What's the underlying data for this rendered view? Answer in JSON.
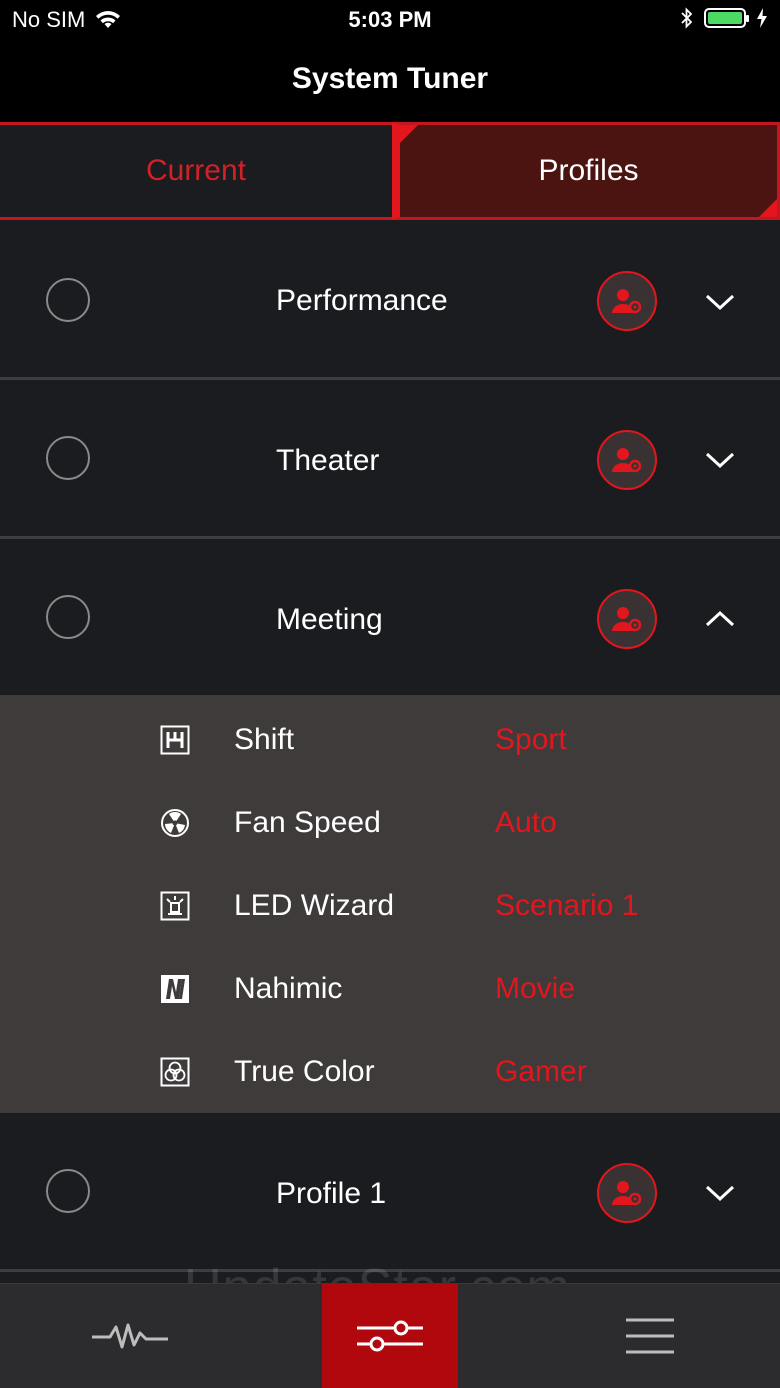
{
  "status_bar": {
    "carrier": "No SIM",
    "time": "5:03 PM",
    "battery_color": "#4cd964"
  },
  "header": {
    "title": "System Tuner"
  },
  "tabs": [
    {
      "label": "Current",
      "active": false
    },
    {
      "label": "Profiles",
      "active": true
    }
  ],
  "profiles": [
    {
      "name": "Performance",
      "selected": false,
      "expanded": false
    },
    {
      "name": "Theater",
      "selected": false,
      "expanded": false
    },
    {
      "name": "Meeting",
      "selected": false,
      "expanded": true
    },
    {
      "name": "Profile 1",
      "selected": false,
      "expanded": false
    }
  ],
  "meeting_settings": [
    {
      "icon": "shift-icon",
      "label": "Shift",
      "value": "Sport"
    },
    {
      "icon": "fan-icon",
      "label": "Fan Speed",
      "value": "Auto"
    },
    {
      "icon": "led-wizard-icon",
      "label": "LED Wizard",
      "value": "Scenario 1"
    },
    {
      "icon": "nahimic-icon",
      "label": "Nahimic",
      "value": "Movie"
    },
    {
      "icon": "true-color-icon",
      "label": "True Color",
      "value": "Gamer"
    }
  ],
  "watermark": "UpdateStar.com",
  "bottom_tabs": [
    {
      "name": "monitor",
      "icon": "pulse-icon",
      "active": false
    },
    {
      "name": "tuner",
      "icon": "sliders-icon",
      "active": true
    },
    {
      "name": "menu",
      "icon": "menu-icon",
      "active": false
    }
  ],
  "colors": {
    "accent_red": "#e3161e",
    "active_tab_bg": "#4b1411",
    "detail_panel_bg": "#3f3b3b",
    "row_bg": "#1b1c1f"
  }
}
